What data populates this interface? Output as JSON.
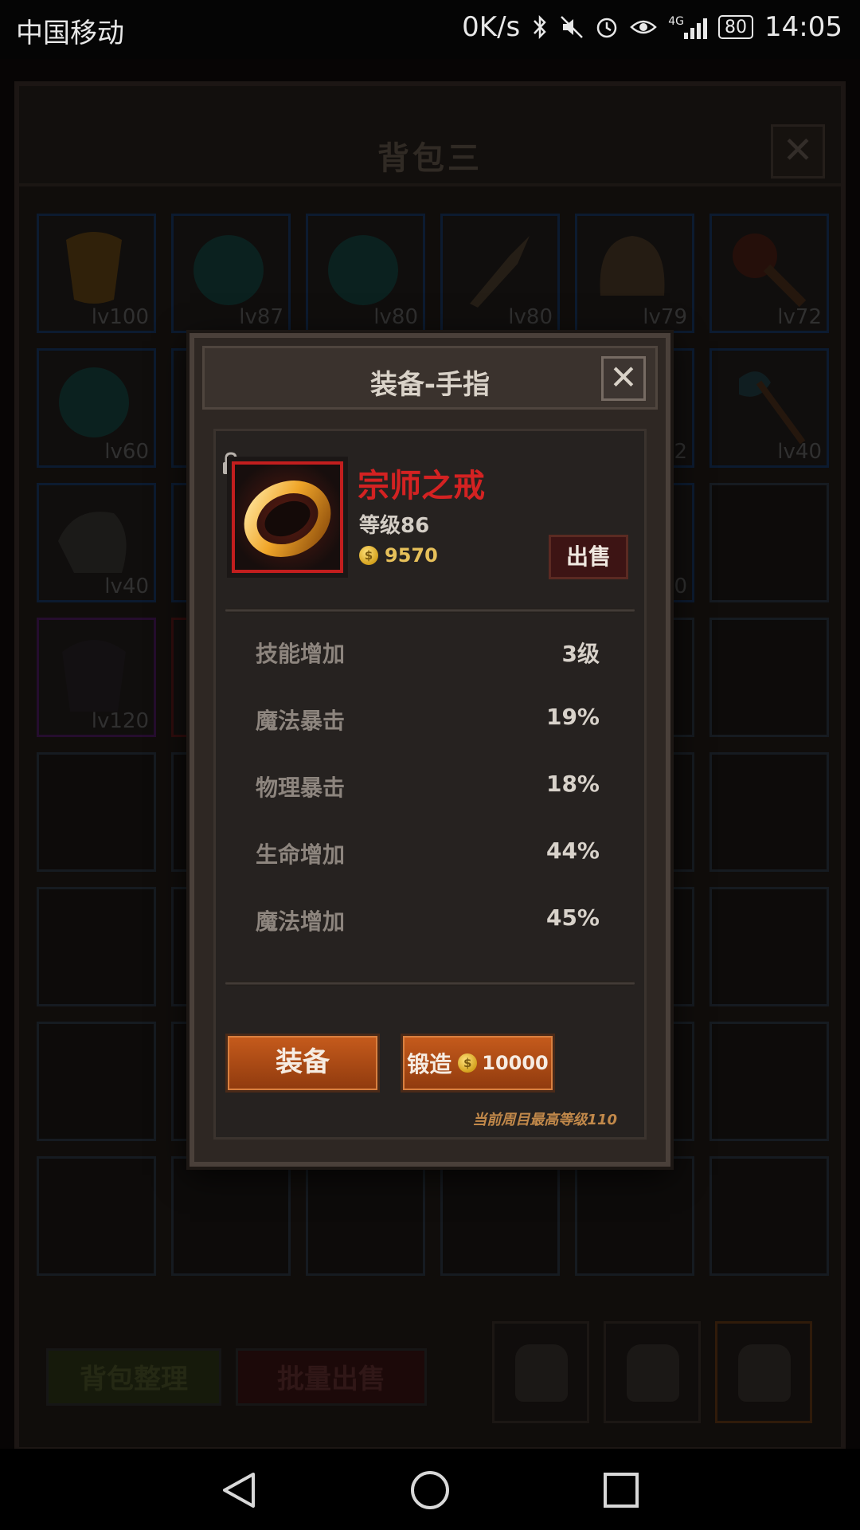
{
  "status_bar": {
    "carrier": "中国移动",
    "speed": "0K/s",
    "network": "4G",
    "battery": "80",
    "time": "14:05"
  },
  "inventory": {
    "title": "背包三",
    "close_symbol": "✕",
    "slots": [
      {
        "level": "lv100",
        "item": "golden-armor"
      },
      {
        "level": "lv87",
        "item": "teal-orb"
      },
      {
        "level": "lv80",
        "item": "teal-orb"
      },
      {
        "level": "lv80",
        "item": "spear"
      },
      {
        "level": "lv79",
        "item": "helmet"
      },
      {
        "level": "lv72",
        "item": "mace"
      },
      {
        "level": "lv60",
        "item": "teal-orb"
      },
      {
        "level": "",
        "item": "hidden"
      },
      {
        "level": "",
        "item": "hidden"
      },
      {
        "level": "",
        "item": "hidden"
      },
      {
        "level": "2",
        "item": "hidden"
      },
      {
        "level": "lv40",
        "item": "axe"
      },
      {
        "level": "lv40",
        "item": "shoulder-armor"
      },
      {
        "level": "",
        "item": "hidden"
      },
      {
        "level": "",
        "item": "hidden"
      },
      {
        "level": "",
        "item": "hidden"
      },
      {
        "level": "20",
        "item": "hidden"
      },
      {
        "level": "",
        "item": "empty"
      },
      {
        "level": "lv120",
        "item": "dark-armor"
      },
      {
        "level": "",
        "item": "hidden"
      }
    ],
    "sort_button": "背包整理",
    "bulk_sell_button": "批量出售"
  },
  "modal": {
    "title": "装备-手指",
    "close_symbol": "✕",
    "item": {
      "name": "宗师之戒",
      "level": "等级86",
      "price": "9570",
      "icon": "gold-ring-icon"
    },
    "sell_button": "出售",
    "stats": [
      {
        "name": "技能增加",
        "value": "3级"
      },
      {
        "name": "魔法暴击",
        "value": "19%"
      },
      {
        "name": "物理暴击",
        "value": "18%"
      },
      {
        "name": "生命增加",
        "value": "44%"
      },
      {
        "name": "魔法增加",
        "value": "45%"
      }
    ],
    "equip_button": "装备",
    "forge_button": "锻造",
    "forge_cost": "10000",
    "forge_note": "当前周目最高等级110"
  },
  "colors": {
    "item_name": "#d42222",
    "gold": "#e6c05a",
    "button_orange": "#c65b1c"
  }
}
